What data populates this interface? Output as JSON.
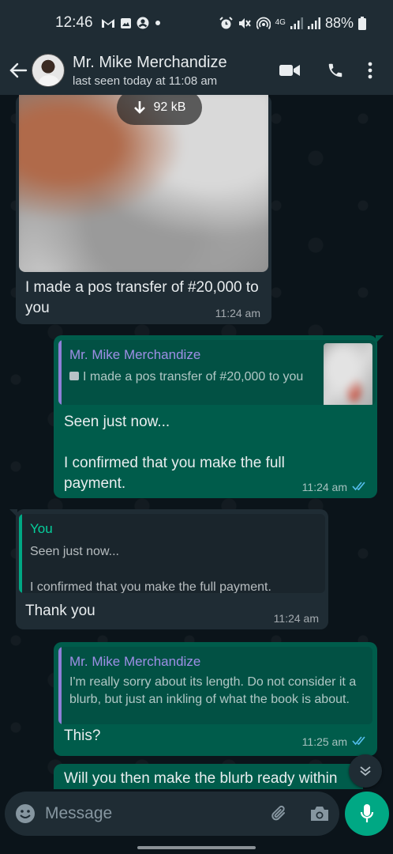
{
  "status_bar": {
    "time": "12:46",
    "left_icons": [
      "gmail-icon",
      "gallery-icon",
      "account-icon",
      "dot-icon"
    ],
    "right_icons": [
      "alarm-icon",
      "mute-icon",
      "hotspot-icon",
      "network-4g-icon",
      "signal-icon",
      "signal-icon-2",
      "battery-icon"
    ],
    "network_label": "4G",
    "battery": "88%"
  },
  "header": {
    "contact_name": "Mr. Mike Merchandize",
    "last_seen": "last seen today at 11:08 am",
    "actions": [
      "video-call-icon",
      "voice-call-icon",
      "more-menu-icon"
    ]
  },
  "messages": {
    "m1": {
      "direction": "incoming",
      "download_size": "92 kB",
      "text": "I made a pos transfer of #20,000 to you",
      "time": "11:24 am"
    },
    "m2": {
      "direction": "outgoing",
      "quote_author": "Mr. Mike Merchandize",
      "quote_text": "I made a pos transfer of #20,000 to you",
      "text_line1": "Seen just now...",
      "text_line2": "I confirmed that you make the full payment.",
      "time": "11:24 am",
      "status": "read"
    },
    "m3": {
      "direction": "incoming",
      "quote_author": "You",
      "quote_line1": "Seen just now...",
      "quote_line2": "I confirmed that you make the full payment.",
      "text": "Thank you",
      "time": "11:24 am"
    },
    "m4": {
      "direction": "outgoing",
      "quote_author": "Mr. Mike Merchandize",
      "quote_text": "I'm really sorry about its length. Do not consider it a blurb, but just an inkling of what the book is about.",
      "text": "This?",
      "time": "11:25 am",
      "status": "read"
    },
    "m5": {
      "direction": "outgoing",
      "text": "Will you then make the blurb ready within"
    }
  },
  "composer": {
    "placeholder": "Message",
    "icons": [
      "emoji-icon",
      "attach-icon",
      "camera-icon",
      "mic-icon"
    ]
  },
  "colors": {
    "background": "#0b141a",
    "header": "#1f2c34",
    "incoming_bubble": "#1f2c34",
    "outgoing_bubble": "#005c4b",
    "accent": "#00a884",
    "read_ticks": "#53bdeb",
    "quote_author_other": "#9e8fe6",
    "quote_author_you": "#06cf9c"
  }
}
